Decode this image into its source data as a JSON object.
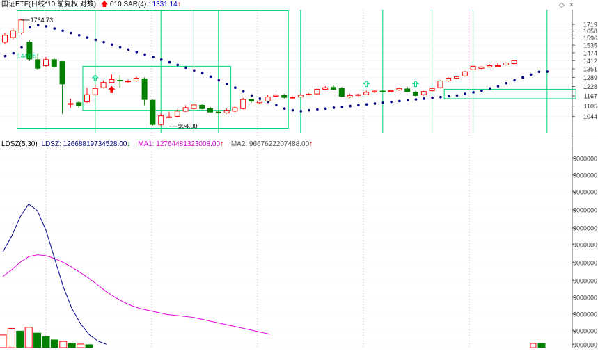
{
  "header": {
    "title": "国证ETF",
    "params": "(日线*10,前复权,对数)",
    "indicator_name": "010 SAR(4)",
    "indicator_value": ": 1331.14"
  },
  "lower_header": {
    "name": "LDSZ(5,30)",
    "ldsz": "LDSZ: 12668819734528.00",
    "ma1": "MA1: 12764481323008.00",
    "ma2": "MA2: 9667622207488.00"
  },
  "window_controls": {
    "restore": "◇",
    "close": "×"
  },
  "colors": {
    "up": "#ff0000",
    "down": "#007f00",
    "sar": "#000080",
    "signal": "#00d27a",
    "ma1": "#e000e0",
    "ldsz_line": "#00008b",
    "ma2": "#e00000",
    "grid": "#bbbbbb"
  },
  "chart_data": [
    {
      "type": "candlestick",
      "title": "国证ETF",
      "scale": "log",
      "ylim": [
        960,
        1860
      ],
      "yticks": [
        1044,
        1105,
        1167,
        1228,
        1289,
        1351,
        1412,
        1474,
        1535,
        1596,
        1658,
        1719
      ],
      "annotations": [
        {
          "text": "1764.73",
          "value": 1764.73,
          "candle": 2
        },
        {
          "text": "994.00",
          "value": 994.0,
          "candle": 20
        },
        {
          "text": "1448.5",
          "value": 1448.5,
          "candle": 2
        }
      ],
      "candles": [
        {
          "o": 1560,
          "c": 1620,
          "h": 1640,
          "l": 1540
        },
        {
          "o": 1600,
          "c": 1660,
          "h": 1680,
          "l": 1585
        },
        {
          "o": 1640,
          "c": 1760,
          "h": 1764.73,
          "l": 1630
        },
        {
          "o": 1560,
          "c": 1425,
          "h": 1575,
          "l": 1410
        },
        {
          "o": 1420,
          "c": 1355,
          "h": 1470,
          "l": 1345
        },
        {
          "o": 1375,
          "c": 1420,
          "h": 1440,
          "l": 1365
        },
        {
          "o": 1420,
          "c": 1370,
          "h": 1435,
          "l": 1360
        },
        {
          "o": 1405,
          "c": 1245,
          "h": 1410,
          "l": 1060
        },
        {
          "o": 1115,
          "c": 1120,
          "h": 1150,
          "l": 1095
        },
        {
          "o": 1125,
          "c": 1108,
          "h": 1135,
          "l": 1095
        },
        {
          "o": 1130,
          "c": 1175,
          "h": 1220,
          "l": 1125
        },
        {
          "o": 1175,
          "c": 1215,
          "h": 1240,
          "l": 1170
        },
        {
          "o": 1220,
          "c": 1255,
          "h": 1270,
          "l": 1215
        },
        {
          "o": 1255,
          "c": 1275,
          "h": 1310,
          "l": 1250
        },
        {
          "o": 1270,
          "c": 1265,
          "h": 1305,
          "l": 1220
        },
        {
          "o": 1260,
          "c": 1265,
          "h": 1275,
          "l": 1250
        },
        {
          "o": 1265,
          "c": 1285,
          "h": 1295,
          "l": 1260
        },
        {
          "o": 1280,
          "c": 1145,
          "h": 1290,
          "l": 1110
        },
        {
          "o": 1140,
          "c": 1000,
          "h": 1145,
          "l": 994
        },
        {
          "o": 1000,
          "c": 1048,
          "h": 1060,
          "l": 994
        },
        {
          "o": 1040,
          "c": 1042,
          "h": 1070,
          "l": 1035
        },
        {
          "o": 1045,
          "c": 1075,
          "h": 1085,
          "l": 1040
        },
        {
          "o": 1075,
          "c": 1095,
          "h": 1110,
          "l": 1070
        },
        {
          "o": 1090,
          "c": 1112,
          "h": 1120,
          "l": 1085
        },
        {
          "o": 1110,
          "c": 1090,
          "h": 1115,
          "l": 1085
        },
        {
          "o": 1090,
          "c": 1070,
          "h": 1100,
          "l": 1065
        },
        {
          "o": 1070,
          "c": 1065,
          "h": 1080,
          "l": 1060
        },
        {
          "o": 1065,
          "c": 1080,
          "h": 1090,
          "l": 1060
        },
        {
          "o": 1075,
          "c": 1095,
          "h": 1105,
          "l": 1070
        },
        {
          "o": 1090,
          "c": 1145,
          "h": 1155,
          "l": 1085
        },
        {
          "o": 1145,
          "c": 1135,
          "h": 1150,
          "l": 1125
        },
        {
          "o": 1125,
          "c": 1135,
          "h": 1140,
          "l": 1120
        },
        {
          "o": 1135,
          "c": 1160,
          "h": 1175,
          "l": 1130
        },
        {
          "o": 1165,
          "c": 1172,
          "h": 1180,
          "l": 1160
        },
        {
          "o": 1172,
          "c": 1158,
          "h": 1180,
          "l": 1150
        },
        {
          "o": 1155,
          "c": 1158,
          "h": 1165,
          "l": 1150
        },
        {
          "o": 1160,
          "c": 1172,
          "h": 1180,
          "l": 1158
        },
        {
          "o": 1175,
          "c": 1178,
          "h": 1185,
          "l": 1170
        },
        {
          "o": 1180,
          "c": 1210,
          "h": 1215,
          "l": 1175
        },
        {
          "o": 1210,
          "c": 1220,
          "h": 1230,
          "l": 1205
        },
        {
          "o": 1222,
          "c": 1210,
          "h": 1235,
          "l": 1205
        },
        {
          "o": 1215,
          "c": 1165,
          "h": 1225,
          "l": 1160
        },
        {
          "o": 1160,
          "c": 1170,
          "h": 1180,
          "l": 1155
        },
        {
          "o": 1172,
          "c": 1175,
          "h": 1180,
          "l": 1165
        },
        {
          "o": 1175,
          "c": 1190,
          "h": 1200,
          "l": 1172
        },
        {
          "o": 1192,
          "c": 1198,
          "h": 1205,
          "l": 1185
        },
        {
          "o": 1198,
          "c": 1195,
          "h": 1205,
          "l": 1190
        },
        {
          "o": 1195,
          "c": 1200,
          "h": 1210,
          "l": 1192
        },
        {
          "o": 1205,
          "c": 1215,
          "h": 1220,
          "l": 1200
        },
        {
          "o": 1212,
          "c": 1195,
          "h": 1225,
          "l": 1190
        },
        {
          "o": 1190,
          "c": 1170,
          "h": 1200,
          "l": 1165
        },
        {
          "o": 1175,
          "c": 1195,
          "h": 1200,
          "l": 1170
        },
        {
          "o": 1200,
          "c": 1215,
          "h": 1225,
          "l": 1195
        },
        {
          "o": 1220,
          "c": 1265,
          "h": 1270,
          "l": 1215
        },
        {
          "o": 1265,
          "c": 1285,
          "h": 1290,
          "l": 1260
        },
        {
          "o": 1285,
          "c": 1295,
          "h": 1300,
          "l": 1280
        },
        {
          "o": 1300,
          "c": 1330,
          "h": 1335,
          "l": 1295
        },
        {
          "o": 1345,
          "c": 1370,
          "h": 1375,
          "l": 1340
        },
        {
          "o": 1355,
          "c": 1365,
          "h": 1370,
          "l": 1350
        },
        {
          "o": 1365,
          "c": 1375,
          "h": 1385,
          "l": 1360
        },
        {
          "o": 1375,
          "c": 1375,
          "h": 1395,
          "l": 1370
        },
        {
          "o": 1380,
          "c": 1395,
          "h": 1400,
          "l": 1375
        },
        {
          "o": 1390,
          "c": 1412,
          "h": 1418,
          "l": 1385
        }
      ],
      "sar": [
        1448,
        1470,
        1520,
        1690,
        1710,
        1700,
        1680,
        1660,
        1640,
        1620,
        1600,
        1580,
        1560,
        1540,
        1520,
        1500,
        1480,
        1460,
        1440,
        1420,
        1400,
        1380,
        1360,
        1340,
        1320,
        1295,
        1270,
        1245,
        1220,
        1195,
        1170,
        1150,
        1130,
        1110,
        1090,
        1080,
        1075,
        1080,
        1085,
        1090,
        1095,
        1100,
        1105,
        1110,
        1115,
        1120,
        1125,
        1130,
        1135,
        1140,
        1145,
        1150,
        1155,
        1160,
        1165,
        1170,
        1180,
        1190,
        1200,
        1215,
        1230,
        1250,
        1270,
        1290,
        1310,
        1330,
        1331.14
      ],
      "signal_lines": [
        11,
        19,
        23,
        26,
        36,
        46,
        52,
        57,
        66,
        73,
        80
      ],
      "boxes": [
        {
          "x0": 2,
          "x1": 34,
          "y0": 980,
          "y1": 1850
        },
        {
          "x0": 10,
          "x1": 27,
          "y0": 1080,
          "y1": 1370
        },
        {
          "x0": 54,
          "x1": 69,
          "y0": 1150,
          "y1": 1210
        }
      ],
      "buy_arrows": [
        11,
        44,
        50,
        87,
        89
      ],
      "up_arrow": 13
    },
    {
      "type": "bar",
      "title": "LDSZ(5,30)",
      "ylim": [
        0,
        9500000000000000
      ],
      "yticks_label": "9000000",
      "bars": [
        {
          "i": 0,
          "v": 1150000000000000,
          "up": true
        },
        {
          "i": 1,
          "v": 1750000000000000,
          "up": true
        },
        {
          "i": 2,
          "v": 1500000000000000,
          "up": false
        },
        {
          "i": 3,
          "v": 1850000000000000,
          "up": true
        },
        {
          "i": 4,
          "v": 1320000000000000,
          "up": false
        },
        {
          "i": 5,
          "v": 1000000000000000,
          "up": false
        },
        {
          "i": 6,
          "v": 700000000000000,
          "up": false
        },
        {
          "i": 7,
          "v": 560000000000000,
          "up": true
        },
        {
          "i": 8,
          "v": 400000000000000,
          "up": false
        },
        {
          "i": 9,
          "v": 320000000000000,
          "up": true
        },
        {
          "i": 10,
          "v": 260000000000000,
          "up": false
        }
      ],
      "ma1": [
        1150,
        1220,
        1300,
        1360,
        1380,
        1370,
        1340,
        1300,
        1250,
        1190,
        1130,
        1060,
        990,
        930,
        880,
        840,
        810,
        790,
        770,
        750,
        740,
        730,
        720,
        700,
        680,
        660,
        640,
        620,
        600,
        580,
        560,
        540
      ],
      "ldsz_line": [
        1180,
        1320,
        1500,
        1620,
        1560,
        1380,
        1120,
        860,
        660,
        520,
        420,
        360,
        330
      ]
    }
  ]
}
